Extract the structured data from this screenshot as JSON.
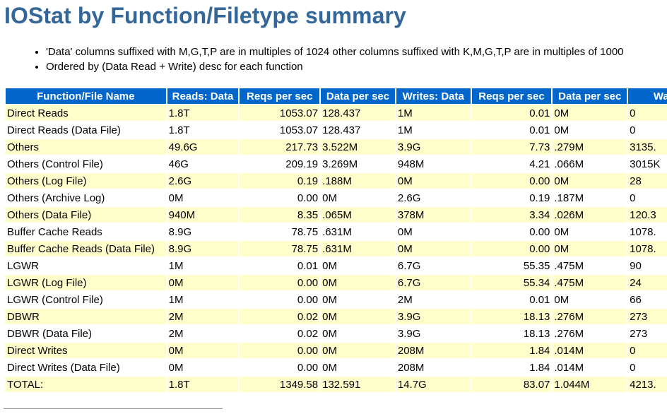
{
  "title": "IOStat by Function/Filetype summary",
  "notes": [
    "'Data' columns suffixed with M,G,T,P are in multiples of 1024 other columns suffixed with K,M,G,T,P are in multiples of 1000",
    "Ordered by (Data Read + Write) desc for each function"
  ],
  "table": {
    "columns": [
      "Function/File Name",
      "Reads: Data",
      "Reqs per sec",
      "Data per sec",
      "Writes: Data",
      "Reqs per sec",
      "Data per sec",
      "Waits"
    ],
    "rows": [
      [
        "Direct Reads",
        "1.8T",
        "1053.07",
        "128.437",
        "1M",
        "0.01",
        "0M",
        "0"
      ],
      [
        "Direct Reads (Data File)",
        "1.8T",
        "1053.07",
        "128.437",
        "1M",
        "0.01",
        "0M",
        "0"
      ],
      [
        "Others",
        "49.6G",
        "217.73",
        "3.522M",
        "3.9G",
        "7.73",
        ".279M",
        "3135."
      ],
      [
        "Others (Control File)",
        "46G",
        "209.19",
        "3.269M",
        "948M",
        "4.21",
        ".066M",
        "3015K"
      ],
      [
        "Others (Log File)",
        "2.6G",
        "0.19",
        ".188M",
        "0M",
        "0.00",
        "0M",
        "28"
      ],
      [
        "Others (Archive Log)",
        "0M",
        "0.00",
        "0M",
        "2.6G",
        "0.19",
        ".187M",
        "0"
      ],
      [
        "Others (Data File)",
        "940M",
        "8.35",
        ".065M",
        "378M",
        "3.34",
        ".026M",
        "120.3"
      ],
      [
        "Buffer Cache Reads",
        "8.9G",
        "78.75",
        ".631M",
        "0M",
        "0.00",
        "0M",
        "1078."
      ],
      [
        "Buffer Cache Reads (Data File)",
        "8.9G",
        "78.75",
        ".631M",
        "0M",
        "0.00",
        "0M",
        "1078."
      ],
      [
        "LGWR",
        "1M",
        "0.01",
        "0M",
        "6.7G",
        "55.35",
        ".475M",
        "90"
      ],
      [
        "LGWR (Log File)",
        "0M",
        "0.00",
        "0M",
        "6.7G",
        "55.34",
        ".475M",
        "24"
      ],
      [
        "LGWR (Control File)",
        "1M",
        "0.00",
        "0M",
        "2M",
        "0.01",
        "0M",
        "66"
      ],
      [
        "DBWR",
        "2M",
        "0.02",
        "0M",
        "3.9G",
        "18.13",
        ".276M",
        "273"
      ],
      [
        "DBWR (Data File)",
        "2M",
        "0.02",
        "0M",
        "3.9G",
        "18.13",
        ".276M",
        "273"
      ],
      [
        "Direct Writes",
        "0M",
        "0.00",
        "0M",
        "208M",
        "1.84",
        ".014M",
        "0"
      ],
      [
        "Direct Writes (Data File)",
        "0M",
        "0.00",
        "0M",
        "208M",
        "1.84",
        ".014M",
        "0"
      ],
      [
        "TOTAL:",
        "1.8T",
        "1349.58",
        "132.591",
        "14.7G",
        "83.07",
        "1.044M",
        "4213."
      ]
    ]
  },
  "colors": {
    "title": "#336699",
    "header_bg": "#0066cc",
    "row_highlight": "#ffffcc"
  }
}
